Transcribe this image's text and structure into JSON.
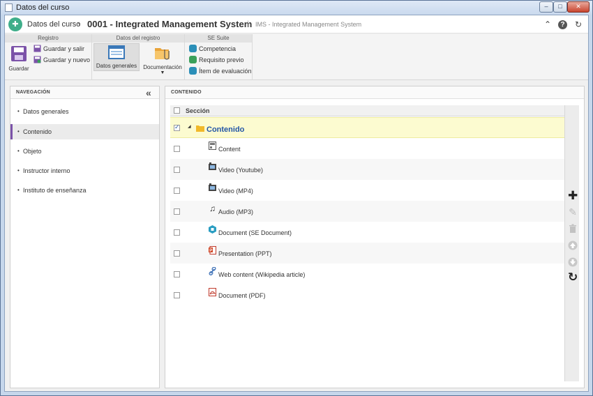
{
  "window": {
    "title": "Datos del curso",
    "min": "–",
    "max": "□",
    "close": "✕"
  },
  "header": {
    "breadcrumb": "Datos del curso",
    "separator": "›",
    "record_title": "0001 - Integrated Management System",
    "pipe": "|",
    "subtitle": "IMS - Integrated Management System"
  },
  "ribbon": {
    "groups": {
      "registro": "Registro",
      "datos_registro": "Datos del registro",
      "se_suite": "SE Suite"
    },
    "guardar": "Guardar",
    "guardar_salir": "Guardar y salir",
    "guardar_nuevo": "Guardar y nuevo",
    "datos_generales": "Datos generales",
    "documentacion": "Documentación",
    "competencia": "Competencia",
    "requisito_previo": "Requisito previo",
    "item_evaluacion": "Ítem de evaluación"
  },
  "nav": {
    "title": "NAVEGACIÓN",
    "collapse": "«",
    "items": [
      {
        "label": "Datos generales",
        "active": false
      },
      {
        "label": "Contenido",
        "active": true
      },
      {
        "label": "Objeto",
        "active": false
      },
      {
        "label": "Instructor interno",
        "active": false
      },
      {
        "label": "Instituto de enseñanza",
        "active": false
      }
    ]
  },
  "content": {
    "title": "CONTENIDO",
    "column_header": "Sección",
    "root": {
      "label": "Contenido",
      "checked": true,
      "expand": "◢"
    },
    "rows": [
      {
        "label": "Content",
        "icon": "content-icon"
      },
      {
        "label": "Video (Youtube)",
        "icon": "video-icon"
      },
      {
        "label": "Video (MP4)",
        "icon": "video-icon"
      },
      {
        "label": "Audio (MP3)",
        "icon": "music-note-icon"
      },
      {
        "label": "Document (SE Document)",
        "icon": "se-document-icon"
      },
      {
        "label": "Presentation (PPT)",
        "icon": "powerpoint-icon"
      },
      {
        "label": "Web content (Wikipedia article)",
        "icon": "link-icon"
      },
      {
        "label": "Document (PDF)",
        "icon": "pdf-icon"
      }
    ]
  },
  "colors": {
    "accent_purple": "#7b52a8",
    "selected_row": "#fcfbd0",
    "root_label": "#2356a6",
    "logo_green": "#3fae8a"
  }
}
